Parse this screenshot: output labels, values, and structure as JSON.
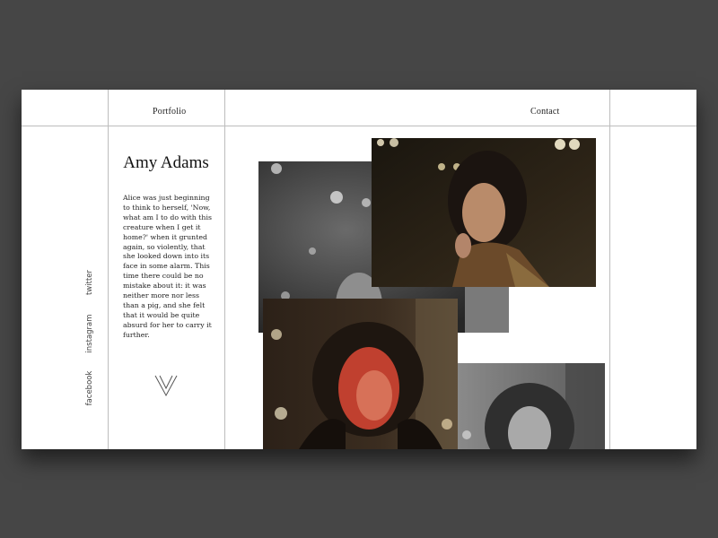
{
  "nav": {
    "portfolio_label": "Portfolio",
    "contact_label": "Contact"
  },
  "profile": {
    "name": "Amy Adams",
    "bio": "Alice was just beginning to think to herself, 'Now, what am I to do with this creature when I get it home?' when it grunted again, so violently, that she looked down into its face in some alarm. This time there could be no mistake about it: it was neither more nor less than a pig, and she felt that it would be quite absurd for her to carry it further."
  },
  "social": {
    "twitter": "twitter",
    "instagram": "instagram",
    "facebook": "facebook"
  },
  "photos": [
    {
      "name": "photo-gray-top",
      "tone": "grayscale"
    },
    {
      "name": "photo-color-top",
      "tone": "color"
    },
    {
      "name": "photo-color-bottom",
      "tone": "color"
    },
    {
      "name": "photo-gray-bottom",
      "tone": "grayscale"
    }
  ],
  "colors": {
    "background": "#464646",
    "card": "#ffffff",
    "divider": "#bdbdbd",
    "text": "#222222"
  }
}
